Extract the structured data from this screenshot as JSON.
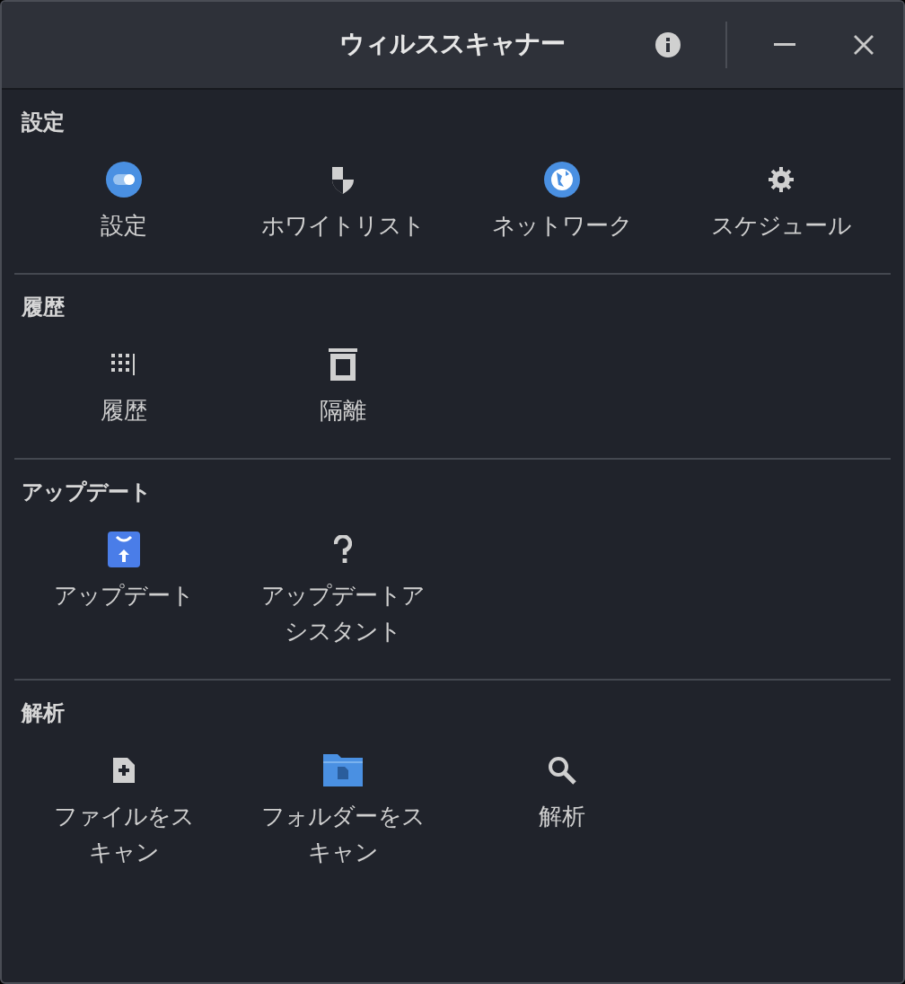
{
  "window": {
    "title": "ウィルススキャナー"
  },
  "sections": [
    {
      "title": "設定",
      "items": [
        {
          "kind": "toggle",
          "label": "設定"
        },
        {
          "kind": "shield",
          "label": "ホワイトリスト"
        },
        {
          "kind": "globe",
          "label": "ネットワーク"
        },
        {
          "kind": "gear",
          "label": "スケジュール"
        }
      ]
    },
    {
      "title": "履歴",
      "items": [
        {
          "kind": "list",
          "label": "履歴"
        },
        {
          "kind": "trash",
          "label": "隔離"
        }
      ]
    },
    {
      "title": "アップデート",
      "items": [
        {
          "kind": "update",
          "label": "アップデート"
        },
        {
          "kind": "question",
          "label": "アップデートアシスタント"
        }
      ]
    },
    {
      "title": "解析",
      "items": [
        {
          "kind": "file",
          "label": "ファイルをスキャン"
        },
        {
          "kind": "folder",
          "label": "フォルダーをスキャン"
        },
        {
          "kind": "search",
          "label": "解析"
        }
      ]
    }
  ]
}
